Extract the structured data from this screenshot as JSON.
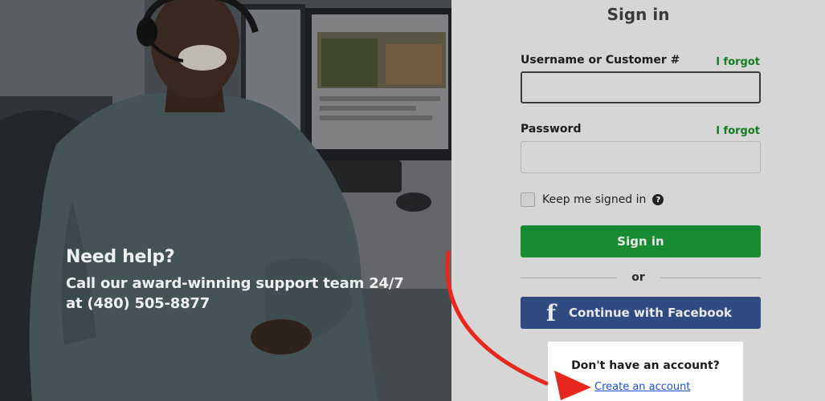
{
  "help_panel": {
    "title": "Need help?",
    "line1": "Call our award-winning support team 24/7",
    "line2": "at (480) 505-8877"
  },
  "form": {
    "title": "Sign in",
    "username": {
      "label": "Username or Customer #",
      "forgot": "I forgot",
      "value": "",
      "placeholder": ""
    },
    "password": {
      "label": "Password",
      "forgot": "I forgot",
      "value": "",
      "placeholder": ""
    },
    "keep_signed_in": {
      "label": "Keep me signed in",
      "checked": false,
      "help_icon": "question-circle-icon"
    },
    "signin_button": "Sign in",
    "or": "or",
    "facebook_button": {
      "label": "Continue with Facebook",
      "icon": "facebook-icon"
    },
    "account": {
      "question": "Don't have an account?",
      "link": "Create an account"
    }
  },
  "colors": {
    "accent_green": "#188a31",
    "forgot_green": "#137d21",
    "facebook_blue": "#2f4b82",
    "link_blue": "#1a4fc9",
    "annotation_red": "#e8281e"
  }
}
